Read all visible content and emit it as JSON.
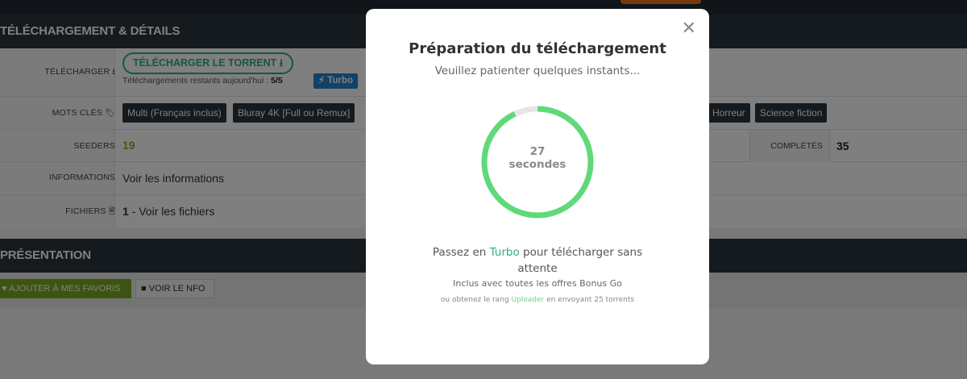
{
  "details": {
    "header": "TÉLÉCHARGEMENT & DÉTAILS",
    "download_label": "TÉLÉCHARGER",
    "download_button": "TÉLÉCHARGER LE TORRENT",
    "remaining_text": "Téléchargements restants aujourd'hui :",
    "remaining_value": "5/5",
    "turbo_badge": "Turbo",
    "keywords_label": "MOTS CLÉS",
    "tags": [
      "Multi (Français inclus)",
      "Bluray 4K [Full ou Remux]",
      "Horreur",
      "Science fiction"
    ],
    "seeders_label": "SEEDERS",
    "seeders_value": "19",
    "completes_label": "COMPLÉTÉS",
    "completes_value": "35",
    "info_label": "INFORMATIONS",
    "info_link": "Voir les informations",
    "files_label": "FICHIERS",
    "files_count": "1",
    "files_link": "- Voir les fichiers"
  },
  "presentation": {
    "header": "PRÉSENTATION",
    "favorites_button": "AJOUTER À MES FAVORIS",
    "nfo_button": "VOIR LE NFO"
  },
  "modal": {
    "title": "Préparation du téléchargement",
    "subtitle": "Veuillez patienter quelques instants...",
    "countdown_value": "27",
    "countdown_unit": "secondes",
    "countdown_progress": 0.93,
    "promo_prefix": "Passez en",
    "promo_turbo": "Turbo",
    "promo_suffix": "pour télécharger sans attente",
    "included": "Inclus avec toutes les offres Bonus Go",
    "rank_prefix": "ou obtenez le rang",
    "rank_name": "Uploader",
    "rank_suffix": "en envoyant 25 torrents"
  },
  "icons": {
    "download": "download-icon",
    "tag": "tags-icon",
    "file": "file-icon",
    "bolt": "bolt-icon",
    "heart": "heart-icon",
    "close": "close-icon"
  },
  "colors": {
    "accent_green": "#2db07a",
    "progress_green": "#5fd97a",
    "turbo_blue": "#2585c9",
    "dark_header": "#2b343c",
    "favorites_green": "#7aa822"
  }
}
